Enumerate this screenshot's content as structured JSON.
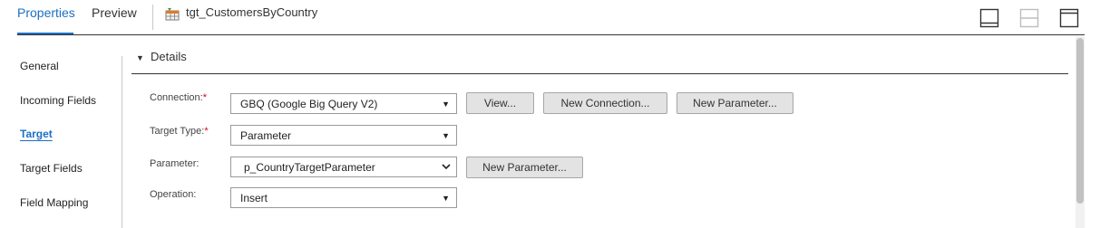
{
  "header": {
    "tabs": [
      {
        "label": "Properties",
        "active": true
      },
      {
        "label": "Preview",
        "active": false
      }
    ],
    "object_name": "tgt_CustomersByCountry",
    "object_icon": "target-table-icon",
    "layout_buttons": [
      "panel-bottom-icon",
      "panel-split-icon",
      "panel-top-icon"
    ]
  },
  "nav": {
    "items": [
      {
        "label": "General",
        "active": false
      },
      {
        "label": "Incoming Fields",
        "active": false
      },
      {
        "label": "Target",
        "active": true
      },
      {
        "label": "Target Fields",
        "active": false
      },
      {
        "label": "Field Mapping",
        "active": false
      }
    ]
  },
  "details": {
    "title": "Details",
    "connection": {
      "label": "Connection:",
      "required": "*",
      "value": "GBQ (Google Big Query V2)",
      "buttons": [
        "View...",
        "New Connection...",
        "New Parameter..."
      ]
    },
    "target_type": {
      "label": "Target Type:",
      "required": "*",
      "value": "Parameter"
    },
    "parameter": {
      "label": "Parameter:",
      "value": "p_CountryTargetParameter",
      "button": "New Parameter..."
    },
    "operation": {
      "label": "Operation:",
      "value": "Insert"
    }
  },
  "colors": {
    "accent": "#1c6fc4",
    "required": "#d0021b",
    "button_bg": "#e3e3e3"
  }
}
